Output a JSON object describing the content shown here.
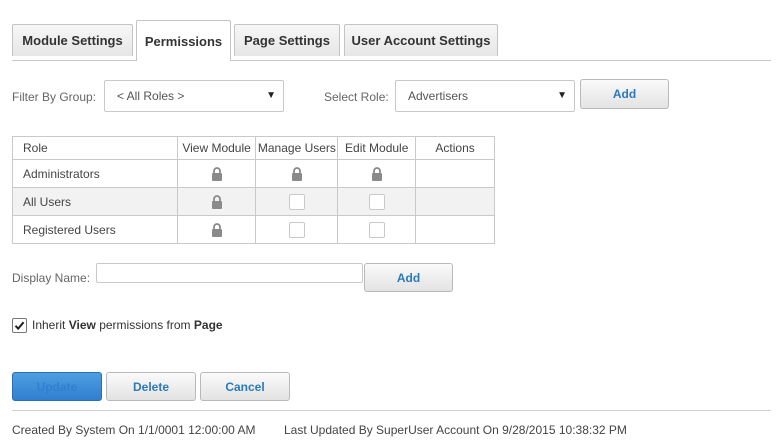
{
  "tabs": [
    {
      "label": "Module Settings"
    },
    {
      "label": "Permissions"
    },
    {
      "label": "Page Settings"
    },
    {
      "label": "User Account Settings"
    }
  ],
  "filter": {
    "group_label": "Filter By Group:",
    "group_value": "< All Roles >",
    "role_label": "Select Role:",
    "role_value": "Advertisers",
    "add_label": "Add"
  },
  "table": {
    "headers": [
      "Role",
      "View Module",
      "Manage Users",
      "Edit Module",
      "Actions"
    ],
    "rows": [
      {
        "role": "Administrators",
        "view": "locked",
        "manage": "locked",
        "edit": "locked"
      },
      {
        "role": "All Users",
        "view": "locked",
        "manage": "unchecked",
        "edit": "unchecked"
      },
      {
        "role": "Registered Users",
        "view": "locked",
        "manage": "unchecked",
        "edit": "unchecked"
      }
    ]
  },
  "display_name": {
    "label": "Display Name:",
    "value": "",
    "add_label": "Add"
  },
  "inherit": {
    "checked": true,
    "prefix": "Inherit",
    "view": "View",
    "middle": "permissions from",
    "page": "Page"
  },
  "actions": {
    "update_label": "Update",
    "delete_label": "Delete",
    "cancel_label": "Cancel"
  },
  "footer": {
    "created": "Created By System On 1/1/0001 12:00:00 AM",
    "updated": "Last Updated By SuperUser Account On 9/28/2015 10:38:32 PM"
  },
  "colors": {
    "primary": "#2f7fcf",
    "link_text": "#2a7ab8"
  }
}
